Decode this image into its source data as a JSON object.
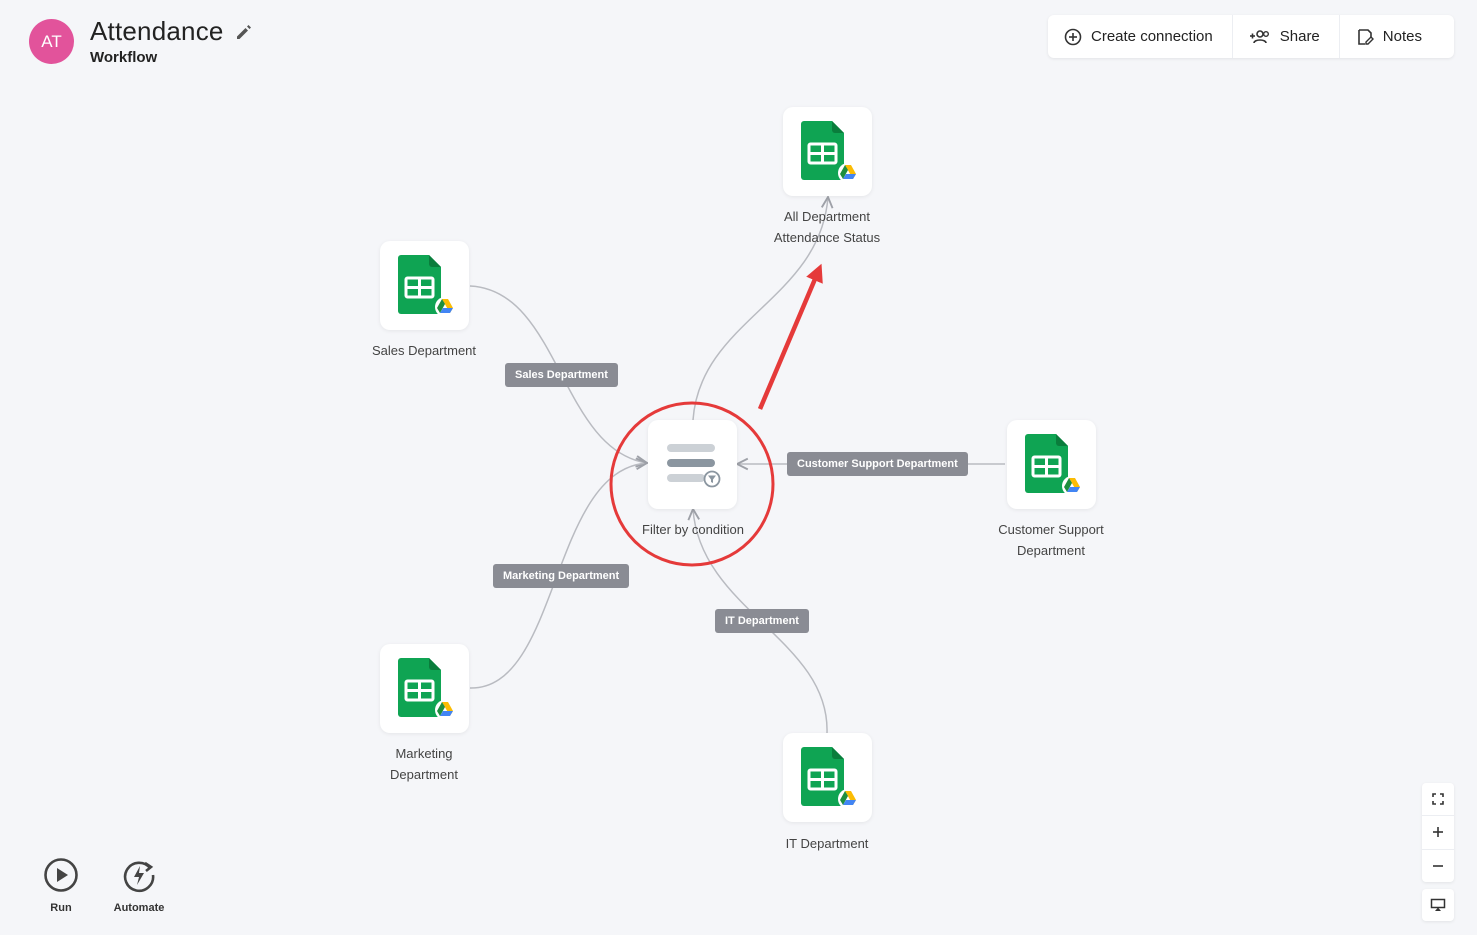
{
  "header": {
    "avatar_initials": "AT",
    "title": "Attendance",
    "subtitle": "Workflow"
  },
  "toolbar": {
    "create_connection": "Create connection",
    "share": "Share",
    "notes": "Notes"
  },
  "nodes": {
    "all_department": {
      "line1": "All Department",
      "line2": "Attendance Status",
      "icon": "google-sheets-icon"
    },
    "sales": {
      "line1": "Sales Department",
      "icon": "google-sheets-icon"
    },
    "filter": {
      "line1": "Filter by condition",
      "icon": "filter-icon"
    },
    "customer_support": {
      "line1": "Customer Support",
      "line2": "Department",
      "icon": "google-sheets-icon"
    },
    "marketing": {
      "line1": "Marketing",
      "line2": "Department",
      "icon": "google-sheets-icon"
    },
    "it": {
      "line1": "IT Department",
      "icon": "google-sheets-icon"
    }
  },
  "edges": {
    "sales": "Sales Department",
    "customer_support": "Customer Support Department",
    "marketing": "Marketing Department",
    "it": "IT Department"
  },
  "bottom": {
    "run": "Run",
    "automate": "Automate"
  },
  "colors": {
    "avatar": "#e2539b",
    "sheets_green": "#0f9d58",
    "highlight_red": "#e53a3a",
    "edge_tag": "#8a8c94"
  }
}
